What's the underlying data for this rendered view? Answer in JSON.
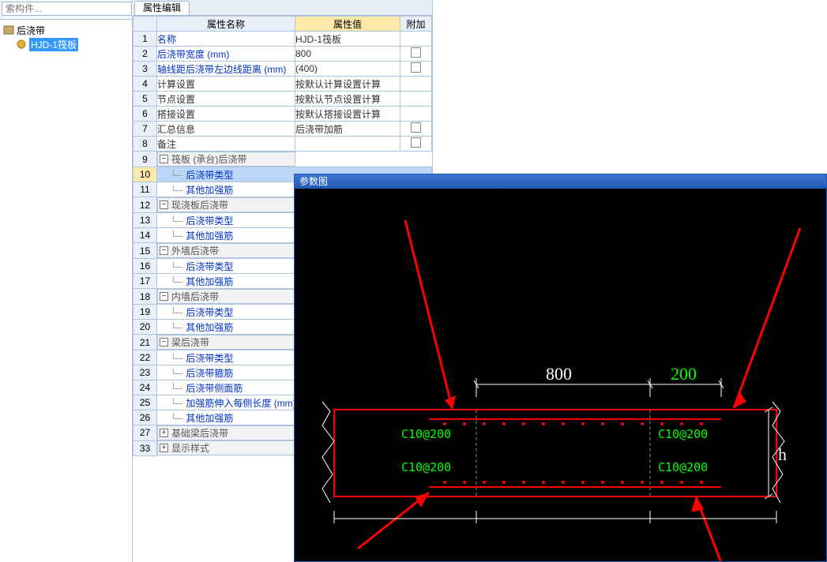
{
  "search": {
    "placeholder": "索构件..."
  },
  "tree": {
    "root": {
      "label": "后浇带"
    },
    "child": {
      "label": "HJD-1筏板"
    }
  },
  "tab": {
    "title": "属性编辑"
  },
  "headers": {
    "name": "属性名称",
    "value": "属性值",
    "extra": "附加"
  },
  "rows": [
    {
      "num": "1",
      "name": "名称",
      "val": "HJD-1筏板",
      "link": true
    },
    {
      "num": "2",
      "name": "后浇带宽度 (mm)",
      "val": "800",
      "link": true,
      "chk": true
    },
    {
      "num": "3",
      "name": "轴线距后浇带左边线距离 (mm)",
      "val": "(400)",
      "link": true,
      "chk": true
    },
    {
      "num": "4",
      "name": "计算设置",
      "val": "按默认计算设置计算"
    },
    {
      "num": "5",
      "name": "节点设置",
      "val": "按默认节点设置计算"
    },
    {
      "num": "6",
      "name": "搭接设置",
      "val": "按默认搭接设置计算"
    },
    {
      "num": "7",
      "name": "汇总信息",
      "val": "后浇带加筋",
      "chk": true
    },
    {
      "num": "8",
      "name": "备注",
      "val": "",
      "chk": true
    }
  ],
  "group1": {
    "num": "9",
    "label": "筏板 (承台)后浇带",
    "exp": "−"
  },
  "g1children": [
    {
      "num": "10",
      "name": "后浇带类型",
      "selected": true
    },
    {
      "num": "11",
      "name": "其他加强筋"
    }
  ],
  "group2": {
    "num": "12",
    "label": "现浇板后浇带",
    "exp": "−"
  },
  "g2children": [
    {
      "num": "13",
      "name": "后浇带类型"
    },
    {
      "num": "14",
      "name": "其他加强筋"
    }
  ],
  "group3": {
    "num": "15",
    "label": "外墙后浇带",
    "exp": "−"
  },
  "g3children": [
    {
      "num": "16",
      "name": "后浇带类型"
    },
    {
      "num": "17",
      "name": "其他加强筋"
    }
  ],
  "group4": {
    "num": "18",
    "label": "内墙后浇带",
    "exp": "−"
  },
  "g4children": [
    {
      "num": "19",
      "name": "后浇带类型"
    },
    {
      "num": "20",
      "name": "其他加强筋"
    }
  ],
  "group5": {
    "num": "21",
    "label": "梁后浇带",
    "exp": "−"
  },
  "g5children": [
    {
      "num": "22",
      "name": "后浇带类型"
    },
    {
      "num": "23",
      "name": "后浇带箍筋"
    },
    {
      "num": "24",
      "name": "后浇带侧面筋"
    },
    {
      "num": "25",
      "name": "加强筋伸入每侧长度 (mm)"
    },
    {
      "num": "26",
      "name": "其他加强筋"
    }
  ],
  "group6": {
    "num": "27",
    "label": "基础梁后浇带",
    "exp": "+"
  },
  "group7": {
    "num": "33",
    "label": "显示样式",
    "exp": "+"
  },
  "diagram": {
    "title": "参数图",
    "dim800": "800",
    "dim200": "200",
    "h": "h",
    "rebar": "C10@200"
  }
}
